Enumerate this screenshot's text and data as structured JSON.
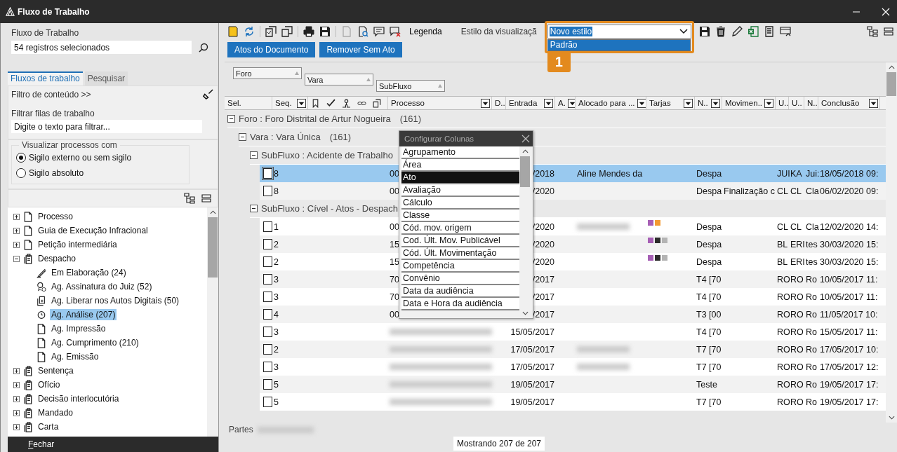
{
  "window": {
    "title": "Fluxo de Trabalho"
  },
  "sidebar": {
    "heading": "Fluxo de Trabalho",
    "selection_field": {
      "value": "54 registros selecionados"
    },
    "tabs": [
      {
        "label": "Fluxos de trabalho",
        "selected": true
      },
      {
        "label": "Pesquisar",
        "selected": false
      }
    ],
    "content_filter": "Filtro de conteúdo >>",
    "queue_filter": {
      "label": "Filtrar filas de trabalho",
      "placeholder": "Digite o texto para filtrar..."
    },
    "visibility": {
      "legend": "Visualizar processos com",
      "options": [
        {
          "label": "Sigilo externo ou sem sigilo",
          "selected": true
        },
        {
          "label": "Sigilo absoluto",
          "selected": false
        }
      ]
    },
    "tree": [
      {
        "label": "Processo",
        "kind": "document",
        "expanded": false,
        "selected": false
      },
      {
        "label": "Guia de Execução Infracional",
        "kind": "document",
        "expanded": false,
        "selected": false
      },
      {
        "label": "Petição intermediária",
        "kind": "document",
        "expanded": false,
        "selected": false
      },
      {
        "label": "Despacho",
        "kind": "stack",
        "expanded": true,
        "selected": false,
        "children": [
          {
            "label": "Em Elaboração (24)",
            "kind": "pen",
            "selected": false
          },
          {
            "label": "Ag. Assinatura do Juiz (52)",
            "kind": "seal",
            "selected": false
          },
          {
            "label": "Ag. Liberar nos Autos Digitais (50)",
            "kind": "release",
            "selected": false
          },
          {
            "label": "Ag. Análise (207)",
            "kind": "clock",
            "selected": true
          },
          {
            "label": "Ag. Impressão",
            "kind": "document",
            "selected": false
          },
          {
            "label": "Ag. Cumprimento (210)",
            "kind": "document",
            "selected": false
          },
          {
            "label": "Ag. Emissão",
            "kind": "document",
            "selected": false
          }
        ]
      },
      {
        "label": "Sentença",
        "kind": "stack",
        "expanded": false,
        "selected": false
      },
      {
        "label": "Ofício",
        "kind": "stack",
        "expanded": false,
        "selected": false
      },
      {
        "label": "Decisão interlocutória",
        "kind": "stack",
        "expanded": false,
        "selected": false
      },
      {
        "label": "Mandado",
        "kind": "stack",
        "expanded": false,
        "selected": false
      },
      {
        "label": "Carta",
        "kind": "stack",
        "expanded": false,
        "selected": false
      }
    ],
    "close_button": "Fechar"
  },
  "toolbar": {
    "legend": "Legenda",
    "style_label": "Estilo da visualizaçã",
    "style_select": {
      "value": "Novo estilo",
      "options": [
        {
          "label": "Padrão",
          "selected": true
        }
      ]
    },
    "callout": "1"
  },
  "actions": [
    "Atos do Documento",
    "Remover Sem Ato"
  ],
  "grouping": [
    "Foro",
    "Vara",
    "SubFluxo"
  ],
  "table": {
    "columns": [
      {
        "label": "Sel.",
        "filter": false
      },
      {
        "label": "Seq.",
        "filter": true
      },
      {
        "kind": "icons"
      },
      {
        "label": "Processo",
        "filter": true
      },
      {
        "label": "D.."
      },
      {
        "label": "Entrada",
        "filter": true
      },
      {
        "label": "A.",
        "filter": true
      },
      {
        "label": "Alocado para ...",
        "filter": true
      },
      {
        "label": "Tarjas",
        "filter": true
      },
      {
        "label": "N..",
        "filter": true
      },
      {
        "label": "Movimen..",
        "filter": true
      },
      {
        "label": "U.."
      },
      {
        "label": "U.."
      },
      {
        "label": "N.."
      },
      {
        "label": "Conclusão",
        "filter": true
      }
    ],
    "groups": [
      {
        "label": "Foro : Foro Distrital de Artur Nogueira",
        "count": "(161)",
        "expanded": true,
        "children": [
          {
            "label": "Vara : Vara Única",
            "count": "(161)",
            "expanded": true,
            "children": [
              {
                "label": "SubFluxo : Acidente de Trabalho",
                "expanded": true,
                "rows": [
                  {
                    "selected": true,
                    "checked": false,
                    "seq": "8",
                    "processo": "00",
                    "entrada": "/2018",
                    "alocado": "Aline Mendes da",
                    "n": "Despa",
                    "u1": "JUI",
                    "u2": "KA",
                    "n2": "Jui:",
                    "conclusao": "18/05/2018 09:"
                  },
                  {
                    "selected": false,
                    "checked": false,
                    "seq": "8",
                    "processo": "00",
                    "entrada": "/2020",
                    "n": "Despa",
                    "movimento": "Finalização c",
                    "u1": "CL",
                    "u2": "CL",
                    "n2": "Cla",
                    "conclusao": "06/02/2020 09:"
                  }
                ]
              },
              {
                "label": "SubFluxo : Cível - Atos - Despach",
                "expanded": true,
                "rows": [
                  {
                    "selected": false,
                    "checked": false,
                    "seq": "1",
                    "processo": "00",
                    "entrada": "/2020",
                    "alocado_blurred": true,
                    "tarjas": [
                      {
                        "color": "#a65fb5"
                      },
                      {
                        "color": "#f39a31"
                      }
                    ],
                    "n": "Despa",
                    "u1": "CL",
                    "u2": "CL",
                    "n2": "Cla",
                    "conclusao": "12/02/2020 14:"
                  },
                  {
                    "selected": false,
                    "checked": false,
                    "seq": "2",
                    "processo": "15",
                    "entrada": "/2020",
                    "tarjas": [
                      {
                        "color": "#a65fb5"
                      },
                      {
                        "color": "#2b2b2b"
                      },
                      {
                        "color": "#b4b4b4"
                      }
                    ],
                    "n": "Despa",
                    "u1": "BL",
                    "u2": "ERI",
                    "n2": "tes",
                    "conclusao": "30/03/2020 15:"
                  },
                  {
                    "selected": false,
                    "checked": false,
                    "seq": "2",
                    "processo": "15",
                    "entrada": "/2020",
                    "tarjas": [
                      {
                        "color": "#a65fb5"
                      },
                      {
                        "color": "#2b2b2b"
                      },
                      {
                        "color": "#b4b4b4"
                      }
                    ],
                    "n": "Despa",
                    "u1": "BL",
                    "u2": "ERI",
                    "n2": "tes",
                    "conclusao": "30/03/2020 15:"
                  },
                  {
                    "selected": false,
                    "checked": false,
                    "seq": "3",
                    "processo": "70",
                    "entrada": "/2017",
                    "n": "T4 [70",
                    "u1": "RO",
                    "u2": "RO",
                    "n2": "Ro",
                    "conclusao": "10/05/2017 11:"
                  },
                  {
                    "selected": false,
                    "checked": false,
                    "seq": "3",
                    "processo": "70",
                    "entrada": "/2017",
                    "n": "T4 [70",
                    "u1": "RO",
                    "u2": "RO",
                    "n2": "Ro",
                    "conclusao": "10/05/2017 11:"
                  },
                  {
                    "selected": false,
                    "checked": false,
                    "seq": "4",
                    "processo": "00",
                    "entrada": "/2017",
                    "n": "T3 [00",
                    "u1": "RO",
                    "u2": "RO",
                    "n2": "Ro",
                    "conclusao": "11/05/2017 10:"
                  },
                  {
                    "selected": false,
                    "checked": false,
                    "seq": "3",
                    "processo_blurred": true,
                    "entrada": "15/05/2017",
                    "n": "T4 [70",
                    "u1": "RO",
                    "u2": "RO",
                    "n2": "Ro",
                    "conclusao": "15/05/2017 11:"
                  },
                  {
                    "selected": false,
                    "checked": false,
                    "seq": "2",
                    "processo_blurred": true,
                    "entrada": "17/05/2017",
                    "alocado_blurred": true,
                    "n": "T7 [70",
                    "u1": "RO",
                    "u2": "RO",
                    "n2": "Ro",
                    "conclusao": "17/05/2017 10:"
                  },
                  {
                    "selected": false,
                    "checked": false,
                    "seq": "3",
                    "processo_blurred": true,
                    "entrada": "17/05/2017",
                    "alocado_blurred": true,
                    "n": "T7 [70",
                    "u1": "RO",
                    "u2": "RO",
                    "n2": "Ro",
                    "conclusao": "17/05/2017 12:"
                  },
                  {
                    "selected": false,
                    "checked": false,
                    "seq": "5",
                    "processo_blurred": true,
                    "entrada": "19/05/2017",
                    "n": "Teste",
                    "u1": "RO",
                    "u2": "RO",
                    "n2": "Ro",
                    "conclusao": "19/05/2017 17:"
                  },
                  {
                    "selected": false,
                    "checked": false,
                    "seq": "5",
                    "processo_blurred": true,
                    "entrada": "19/05/2017",
                    "n": "T7 [70",
                    "u1": "RO",
                    "u2": "RO",
                    "n2": "Ro",
                    "conclusao": "19/05/2017 17:"
                  }
                ]
              }
            ]
          }
        ]
      }
    ]
  },
  "column_dialog": {
    "title": "Configurar Colunas",
    "items": [
      {
        "label": "Agrupamento",
        "selected": false
      },
      {
        "label": "Área",
        "selected": false
      },
      {
        "label": "Ato",
        "selected": true
      },
      {
        "label": "Avaliação",
        "selected": false
      },
      {
        "label": "Cálculo",
        "selected": false
      },
      {
        "label": "Classe",
        "selected": false
      },
      {
        "label": "Cód. mov. origem",
        "selected": false
      },
      {
        "label": "Cod. Últ. Mov. Publicável",
        "selected": false
      },
      {
        "label": "Cód. Últ. Movimentação",
        "selected": false
      },
      {
        "label": "Competência",
        "selected": false
      },
      {
        "label": "Convênio",
        "selected": false
      },
      {
        "label": "Data da audiência",
        "selected": false
      },
      {
        "label": "Data e Hora da audiência",
        "selected": false
      }
    ]
  },
  "footer": {
    "parties_label": "Partes",
    "parties_blurred": true,
    "status": "Mostrando 207 de 207"
  }
}
